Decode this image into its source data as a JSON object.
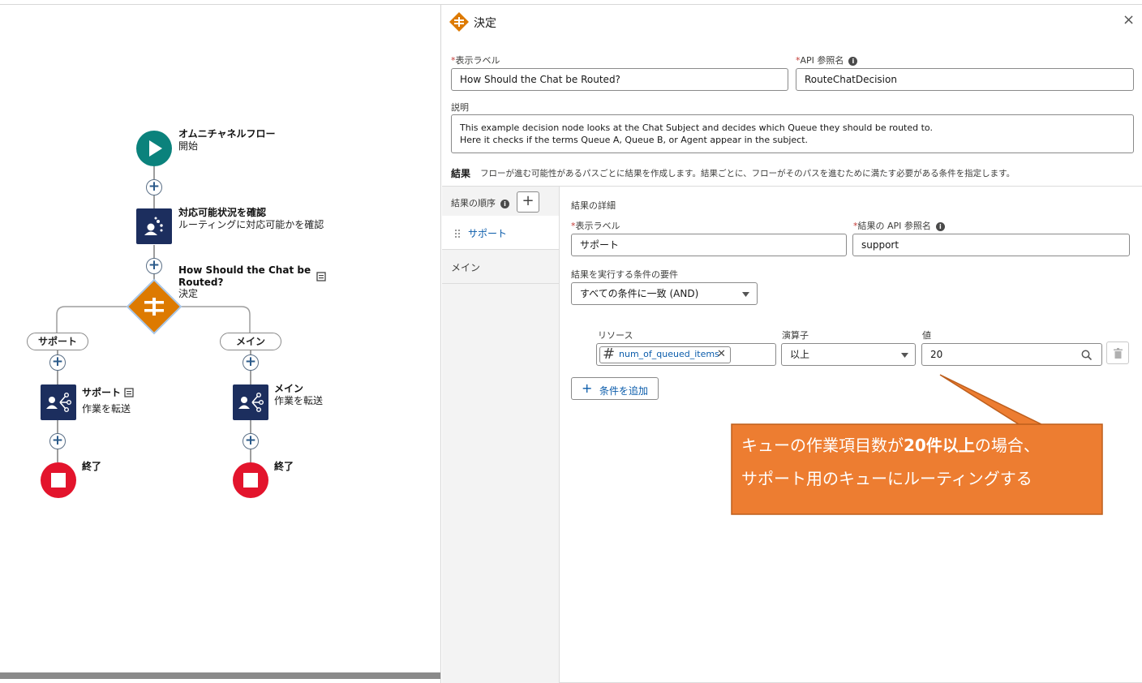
{
  "canvas": {
    "start": {
      "title": "オムニチャネルフロー",
      "subtitle": "開始"
    },
    "check": {
      "title": "対応可能状況を確認",
      "subtitle": "ルーティングに対応可能かを確認"
    },
    "decision": {
      "title_line1": "How Should the Chat be",
      "title_line2": "Routed?",
      "subtitle": "決定"
    },
    "branch_left": {
      "pill": "サポート",
      "title": "サポート",
      "subtitle": "作業を転送",
      "end": "終了"
    },
    "branch_right": {
      "pill": "メイン",
      "title": "メイン",
      "subtitle": "作業を転送",
      "end": "終了"
    }
  },
  "panel": {
    "title": "決定",
    "close": "×",
    "label_field": {
      "label": "表示ラベル",
      "value": "How Should the Chat be Routed?"
    },
    "api_field": {
      "label": "API 参照名",
      "value": "RouteChatDecision"
    },
    "description": {
      "label": "説明",
      "line1": "This example decision node looks at the Chat Subject and decides which Queue they should be routed to.",
      "line2": "Here it checks if the terms Queue A, Queue B, or Agent appear in the subject."
    },
    "outcomes": {
      "heading": "結果",
      "help": "フローが進む可能性があるパスごとに結果を作成します。結果ごとに、フローがそのパスを進むために満たす必要がある条件を指定します。",
      "order_label": "結果の順序",
      "add": "+",
      "items": [
        {
          "label": "サポート"
        },
        {
          "label": "メイン"
        }
      ]
    },
    "detail": {
      "heading": "結果の詳細",
      "label_field": {
        "label": "表示ラベル",
        "value": "サポート"
      },
      "api_field": {
        "label": "結果の API 参照名",
        "value": "support"
      },
      "condition_req": {
        "label": "結果を実行する条件の要件",
        "value": "すべての条件に一致 (AND)"
      },
      "condition": {
        "resource_label": "リソース",
        "resource_value": "num_of_queued_items",
        "operator_label": "演算子",
        "operator_value": "以上",
        "value_label": "値",
        "value_value": "20"
      },
      "add_condition": "条件を追加"
    }
  },
  "callout": {
    "line1_pre": "キューの作業項目数が",
    "line1_bold": "20件以上",
    "line1_post": "の場合、",
    "line2": "サポート用のキューにルーティングする",
    "color": "#ed7d31"
  }
}
